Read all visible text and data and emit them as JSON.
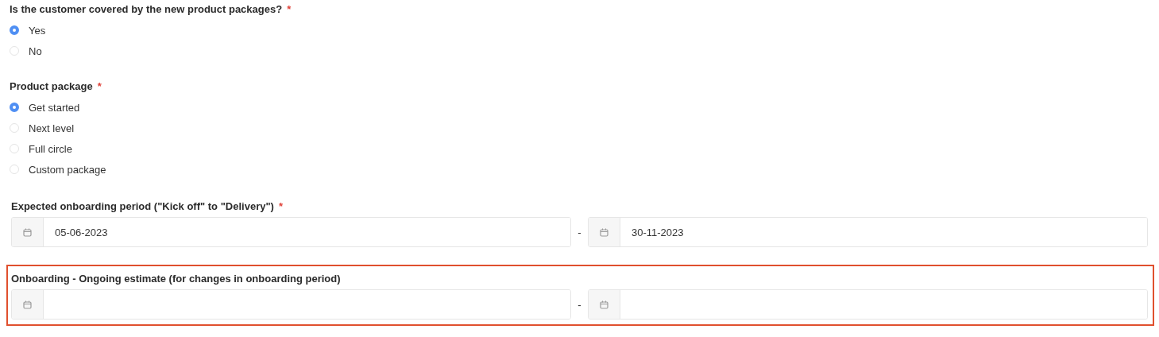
{
  "questions": [
    {
      "kind": "radio",
      "label": "Is the customer covered by the new product packages?",
      "required_mark": "*",
      "options": [
        {
          "label": "Yes",
          "selected": true
        },
        {
          "label": "No",
          "selected": false
        }
      ]
    },
    {
      "kind": "radio",
      "label": "Product package",
      "required_mark": "*",
      "options": [
        {
          "label": "Get started",
          "selected": true
        },
        {
          "label": "Next level",
          "selected": false
        },
        {
          "label": "Full circle",
          "selected": false
        },
        {
          "label": "Custom package",
          "selected": false
        }
      ]
    },
    {
      "kind": "date_range",
      "label": "Expected onboarding period (\"Kick off\" to \"Delivery\")",
      "required_mark": "*",
      "highlighted": false,
      "separator": "-",
      "from": {
        "value": "05-06-2023"
      },
      "to": {
        "value": "30-11-2023"
      }
    },
    {
      "kind": "date_range",
      "label": "Onboarding - Ongoing estimate (for changes in onboarding period)",
      "highlighted": true,
      "separator": "-"
    }
  ]
}
